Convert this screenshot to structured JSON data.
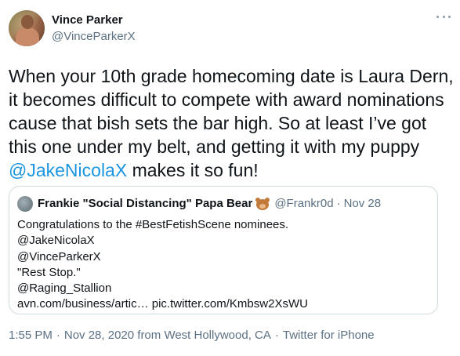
{
  "author": {
    "name": "Vince Parker",
    "handle": "@VinceParkerX"
  },
  "tweet": {
    "text_before": "When your 10th grade homecoming date is Laura Dern, it becomes difficult to compete with award nominations cause that bish sets the bar high. So at least I’ve got this one under my belt, and getting it with my puppy ",
    "mention": "@JakeNicolaX",
    "text_after": " makes it so fun!"
  },
  "quoted_tweet": {
    "name": "Frankie \"Social Distancing\" Papa Bear",
    "name_emoji": "bear-face-icon",
    "handle": "@Frankr0d",
    "dot": "·",
    "date": "Nov 28",
    "lines": [
      "Congratulations to the #BestFetishScene nominees.",
      "@JakeNicolaX",
      "@VinceParkerX",
      "\"Rest Stop.\"",
      "@Raging_Stallion",
      "avn.com/business/artic… pic.twitter.com/Kmbsw2XsWU"
    ]
  },
  "meta": {
    "time": "1:55 PM",
    "sep": "·",
    "date": "Nov 28, 2020 from West Hollywood, CA",
    "app": "Twitter for iPhone"
  },
  "colors": {
    "link": "#1b95e0",
    "secondary_text": "#5b7083",
    "border": "#cfd9de"
  }
}
